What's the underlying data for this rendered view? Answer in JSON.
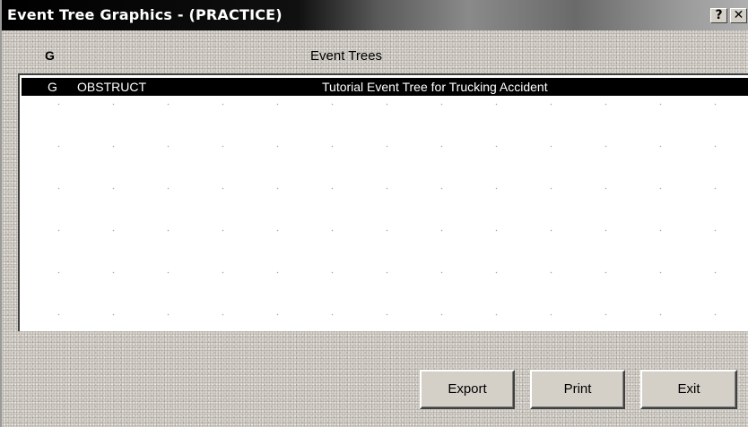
{
  "window": {
    "title": "Event Tree Graphics  - (PRACTICE)",
    "help_label": "?",
    "close_label": "✕"
  },
  "list": {
    "columns": {
      "g": "G",
      "title": "Event Trees"
    },
    "rows": [
      {
        "g": "G",
        "name": "OBSTRUCT",
        "description": "Tutorial Event Tree for Trucking Accident",
        "selected": true
      }
    ]
  },
  "buttons": {
    "export": "Export",
    "print": "Print",
    "exit": "Exit"
  },
  "colors": {
    "titlebar": "#000000",
    "face": "#d4d0c8",
    "selection": "#000000",
    "selection_text": "#ffffff"
  }
}
